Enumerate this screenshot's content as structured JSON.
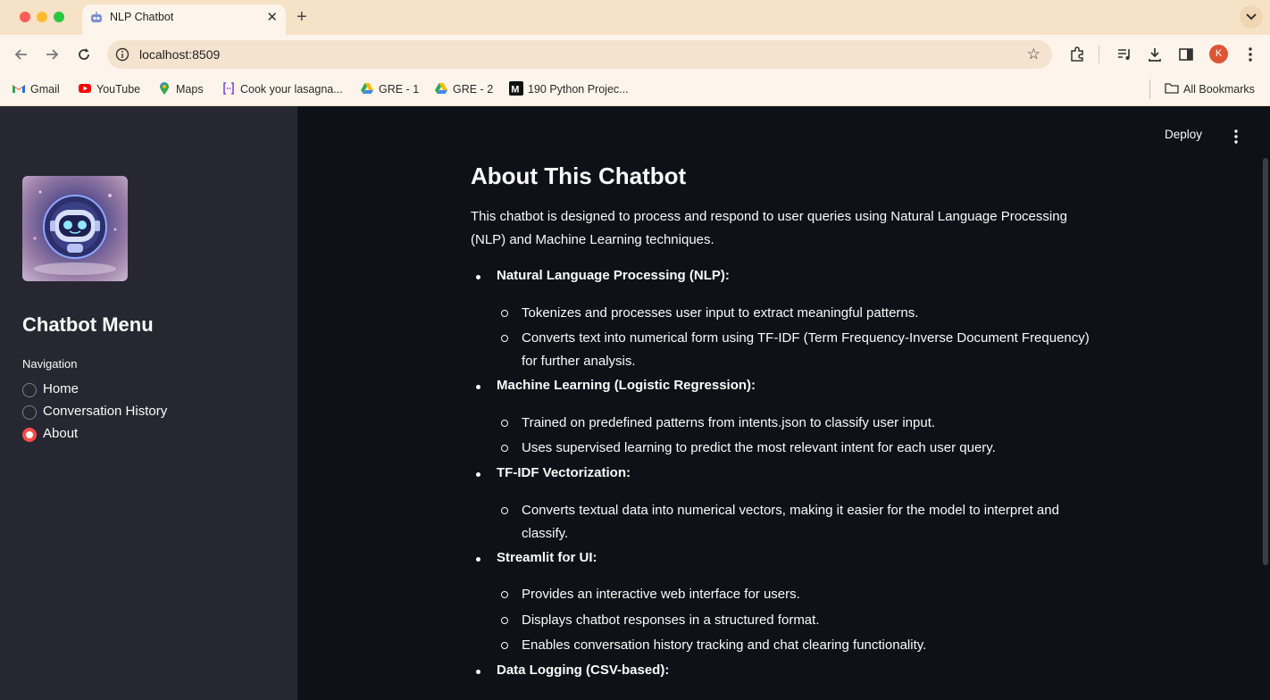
{
  "browser": {
    "tab_title": "NLP Chatbot",
    "url": "localhost:8509",
    "profile_initial": "K",
    "bookmarks": [
      {
        "label": "Gmail",
        "icon": "gmail-icon"
      },
      {
        "label": "YouTube",
        "icon": "youtube-icon"
      },
      {
        "label": "Maps",
        "icon": "maps-icon"
      },
      {
        "label": "Cook your lasagna...",
        "icon": "code-bracket-icon"
      },
      {
        "label": "GRE - 1",
        "icon": "drive-icon"
      },
      {
        "label": "GRE - 2",
        "icon": "drive-icon"
      },
      {
        "label": "190 Python Projec...",
        "icon": "medium-icon"
      }
    ],
    "all_bookmarks": "All Bookmarks"
  },
  "sidebar": {
    "title": "Chatbot Menu",
    "nav_label": "Navigation",
    "options": [
      {
        "label": "Home",
        "selected": false
      },
      {
        "label": "Conversation History",
        "selected": false
      },
      {
        "label": "About",
        "selected": true
      }
    ]
  },
  "header": {
    "deploy": "Deploy"
  },
  "content": {
    "heading": "About This Chatbot",
    "intro": "This chatbot is designed to process and respond to user queries using Natural Language Processing (NLP) and Machine Learning techniques.",
    "sections": [
      {
        "title": "Natural Language Processing (NLP):",
        "items": [
          "Tokenizes and processes user input to extract meaningful patterns.",
          "Converts text into numerical form using TF-IDF (Term Frequency-Inverse Document Frequency) for further analysis."
        ]
      },
      {
        "title": "Machine Learning (Logistic Regression):",
        "items": [
          "Trained on predefined patterns from intents.json to classify user input.",
          "Uses supervised learning to predict the most relevant intent for each user query."
        ]
      },
      {
        "title": "TF-IDF Vectorization:",
        "items": [
          "Converts textual data into numerical vectors, making it easier for the model to interpret and classify."
        ]
      },
      {
        "title": "Streamlit for UI:",
        "items": [
          "Provides an interactive web interface for users.",
          "Displays chatbot responses in a structured format.",
          "Enables conversation history tracking and chat clearing functionality."
        ]
      },
      {
        "title": "Data Logging (CSV-based):",
        "items": []
      }
    ]
  },
  "colors": {
    "accent": "#ff4b4b",
    "sidebar_bg": "#262730",
    "main_bg": "#0e1117",
    "text": "#fafafa"
  }
}
